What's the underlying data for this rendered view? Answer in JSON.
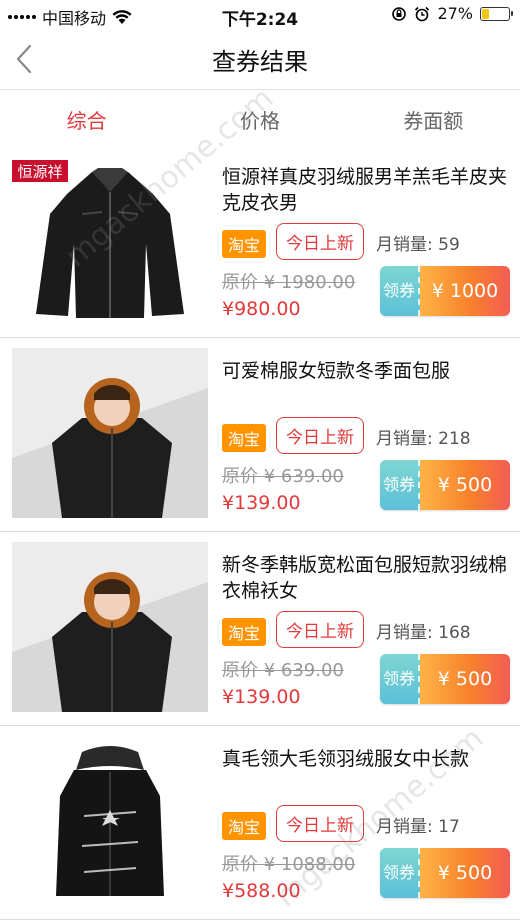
{
  "status_bar": {
    "carrier": "中国移动",
    "time": "下午2:24",
    "battery_percent": "27%",
    "battery_level": 0.27
  },
  "nav": {
    "title": "查券结果",
    "back_icon": "chevron-left-icon"
  },
  "tabs": [
    {
      "label": "综合",
      "active": true
    },
    {
      "label": "价格",
      "active": false
    },
    {
      "label": "券面额",
      "active": false
    }
  ],
  "products": [
    {
      "title": "恒源祥真皮羽绒服男羊羔毛羊皮夹克皮衣男",
      "brand_logo": "恒源祥",
      "platform": "淘宝",
      "tag": "今日上新",
      "sales": "月销量: 59",
      "original_price": "原价 ¥ 1980.00",
      "price": "¥980.00",
      "coupon_label": "领券",
      "coupon_amount": "¥ 1000"
    },
    {
      "title": "可爱棉服女短款冬季面包服",
      "platform": "淘宝",
      "tag": "今日上新",
      "sales": "月销量: 218",
      "original_price": "原价 ¥ 639.00",
      "price": "¥139.00",
      "coupon_label": "领券",
      "coupon_amount": "¥ 500"
    },
    {
      "title": "新冬季韩版宽松面包服短款羽绒棉衣棉袄女",
      "platform": "淘宝",
      "tag": "今日上新",
      "sales": "月销量: 168",
      "original_price": "原价 ¥ 639.00",
      "price": "¥139.00",
      "coupon_label": "领券",
      "coupon_amount": "¥ 500"
    },
    {
      "title": "真毛领大毛领羽绒服女中长款",
      "platform": "淘宝",
      "tag": "今日上新",
      "sales": "月销量: 17",
      "original_price": "原价 ¥ 1088.00",
      "price": "¥588.00",
      "coupon_label": "领券",
      "coupon_amount": "¥ 500"
    }
  ],
  "watermark": "mgackhome.com",
  "colors": {
    "accent_red": "#e23a3a",
    "taobao_orange": "#ff9300",
    "coupon_gradient_start": "#ffb347",
    "coupon_gradient_end": "#f45c53",
    "coupon_left": "#6ccbd5"
  }
}
